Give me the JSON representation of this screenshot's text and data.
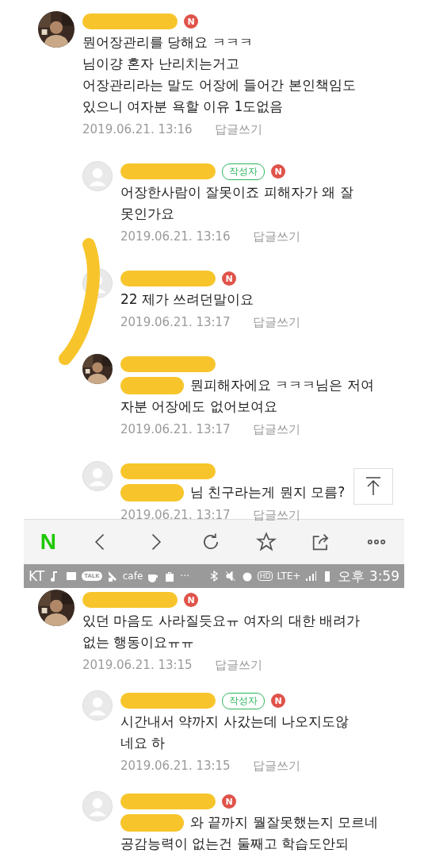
{
  "upper_thread": {
    "comments": [
      {
        "kind": "top",
        "has_photo": true,
        "new_mark": "N",
        "lines": [
          "뭔어장관리를 당해요 ㅋㅋㅋ",
          "님이걍 혼자 난리치는거고",
          "어장관리라는 말도 어장에 들어간 본인책임도",
          "있으니 여자분 욕할 이유 1도없음"
        ],
        "date": "2019.06.21. 13:16",
        "reply_link": "답글쓰기"
      },
      {
        "kind": "reply",
        "has_photo": false,
        "tag": "작성자",
        "new_mark": "N",
        "lines": [
          "어장한사람이 잘못이죠 피해자가 왜 잘",
          "못인가요"
        ],
        "date": "2019.06.21. 13:16",
        "reply_link": "답글쓰기"
      },
      {
        "kind": "reply",
        "has_photo": false,
        "new_mark": "N",
        "lines": [
          "22 제가 쓰려던말이요"
        ],
        "date": "2019.06.21. 13:17",
        "reply_link": "답글쓰기"
      },
      {
        "kind": "reply",
        "has_photo": true,
        "redacted_prefix": true,
        "lines": [
          "뭔피해자에요 ㅋㅋㅋ님은 저여",
          "자분 어장에도 없어보여요"
        ],
        "date": "2019.06.21. 13:17",
        "reply_link": "답글쓰기"
      },
      {
        "kind": "reply",
        "has_photo": false,
        "redacted_prefix": true,
        "lines": [
          "님 친구라는게 뭔지 모름?"
        ],
        "date": "2019.06.21. 13:17",
        "reply_link": "답글쓰기"
      }
    ]
  },
  "browser_toolbar": {
    "logo": "N"
  },
  "status_bar": {
    "carrier": "KT",
    "talk": "TALK",
    "cafe": "cafe",
    "more": "···",
    "hd": "HD",
    "network": "LTE+",
    "time": "오후 3:59"
  },
  "lower_thread": {
    "comments": [
      {
        "kind": "top",
        "has_photo": true,
        "new_mark": "N",
        "lines": [
          "있던 마음도 사라질듯요ㅠ 여자의 대한 배려가",
          "없는 행동이요ㅠㅠ"
        ],
        "date": "2019.06.21. 13:15",
        "reply_link": "답글쓰기"
      },
      {
        "kind": "reply",
        "has_photo": false,
        "tag": "작성자",
        "new_mark": "N",
        "lines": [
          "시간내서 약까지 사갔는데 나오지도않",
          "네요 하"
        ],
        "date": "2019.06.21. 13:15",
        "reply_link": "답글쓰기"
      },
      {
        "kind": "reply",
        "has_photo": false,
        "new_mark": "N",
        "redacted_prefix": true,
        "lines": [
          "와 끝까지 뭘잘못했는지 모르네",
          "공감능력이 없는건 둘째고 학습도안되"
        ]
      }
    ]
  }
}
